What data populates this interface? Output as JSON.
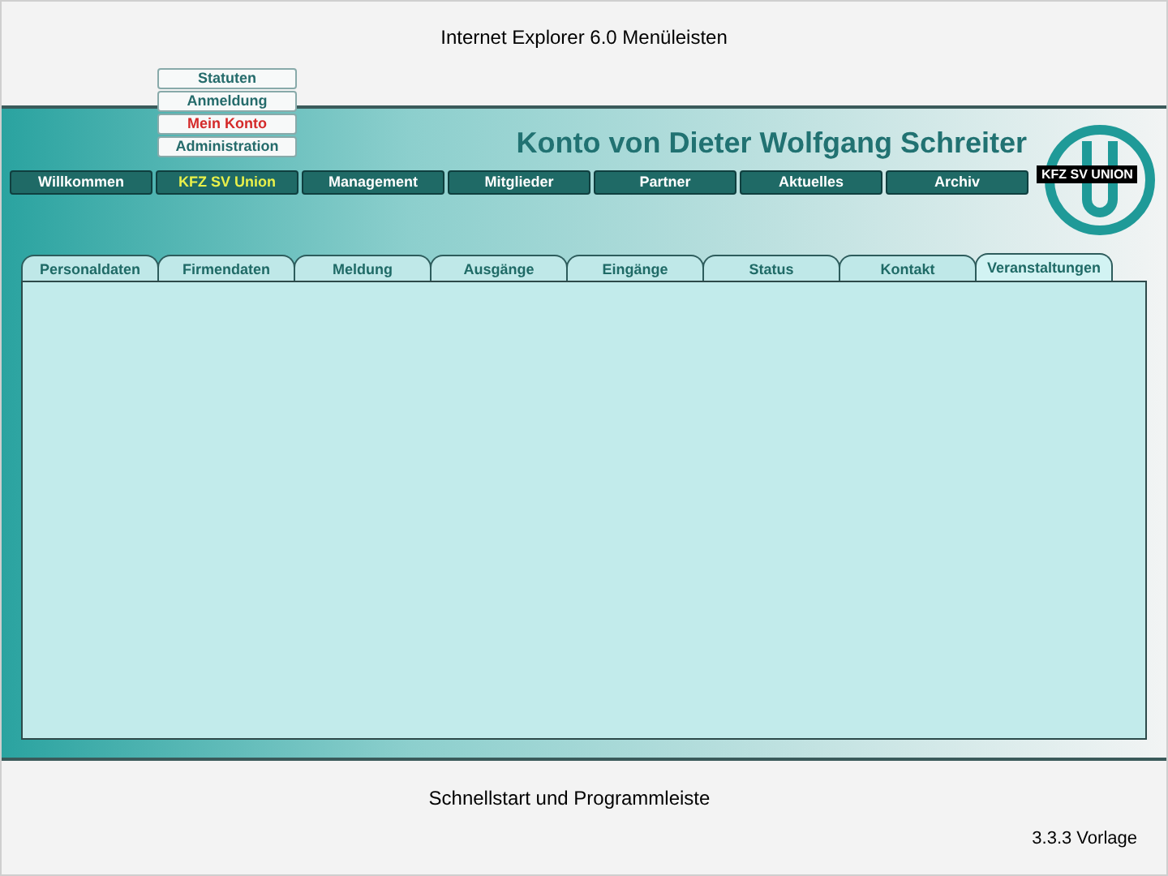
{
  "window": {
    "title": "Internet Explorer 6.0 Menüleisten"
  },
  "submenu": [
    {
      "label": "Statuten",
      "selected": false
    },
    {
      "label": "Anmeldung",
      "selected": false
    },
    {
      "label": "Mein Konto",
      "selected": true
    },
    {
      "label": "Administration",
      "selected": false
    }
  ],
  "heading": "Konto von Dieter Wolfgang Schreiter",
  "logo": {
    "text": "KFZ SV UNION"
  },
  "nav": [
    {
      "label": "Willkommen",
      "selected": false
    },
    {
      "label": "KFZ SV Union",
      "selected": true
    },
    {
      "label": "Management",
      "selected": false
    },
    {
      "label": "Mitglieder",
      "selected": false
    },
    {
      "label": "Partner",
      "selected": false
    },
    {
      "label": "Aktuelles",
      "selected": false
    },
    {
      "label": "Archiv",
      "selected": false
    }
  ],
  "tabs": [
    {
      "label": "Personaldaten",
      "selected": false
    },
    {
      "label": "Firmendaten",
      "selected": false
    },
    {
      "label": "Meldung",
      "selected": false
    },
    {
      "label": "Ausgänge",
      "selected": false
    },
    {
      "label": "Eingänge",
      "selected": false
    },
    {
      "label": "Status",
      "selected": false
    },
    {
      "label": "Kontakt",
      "selected": false
    },
    {
      "label": "Veranstaltungen",
      "selected": true
    }
  ],
  "footer": {
    "caption": "Schnellstart und Programmleiste",
    "version": "3.3.3 Vorlage"
  }
}
